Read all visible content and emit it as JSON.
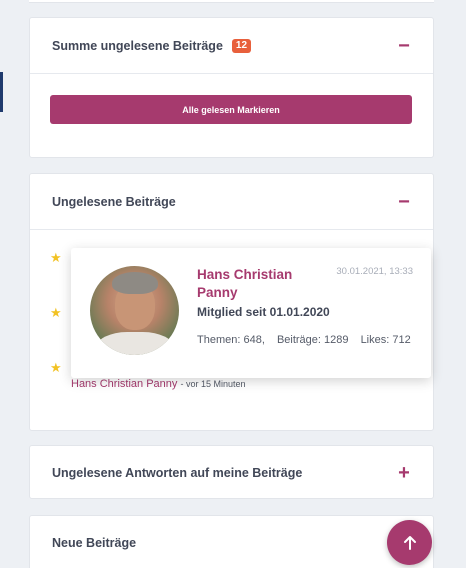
{
  "colors": {
    "accent": "#a63a6e",
    "badge": "#e8603c",
    "star": "#f2c224"
  },
  "unread_summary": {
    "title": "Summe ungelesene Beiträge",
    "count": "12",
    "toggle": "−",
    "mark_all_label": "Alle gelesen Markieren"
  },
  "unread_posts": {
    "title": "Ungelesene Beiträge",
    "toggle": "−",
    "items": [
      {
        "icon": "star-icon"
      },
      {
        "icon": "star-icon"
      },
      {
        "icon": "star-icon",
        "author": "Hans Christian Panny",
        "time": "- vor 15 Minuten"
      }
    ]
  },
  "user_popover": {
    "name": "Hans Christian Panny",
    "date": "30.01.2021, 13:33",
    "member_since": "Mitglied seit 01.01.2020",
    "topics": "Themen: 648,",
    "posts": "Beiträge: 1289",
    "likes": "Likes: 712"
  },
  "unread_replies": {
    "title": "Ungelesene Antworten auf meine Beiträge",
    "toggle": "+"
  },
  "new_posts": {
    "title": "Neue Beiträge"
  },
  "scroll_top": {
    "icon": "arrow-up-icon"
  }
}
